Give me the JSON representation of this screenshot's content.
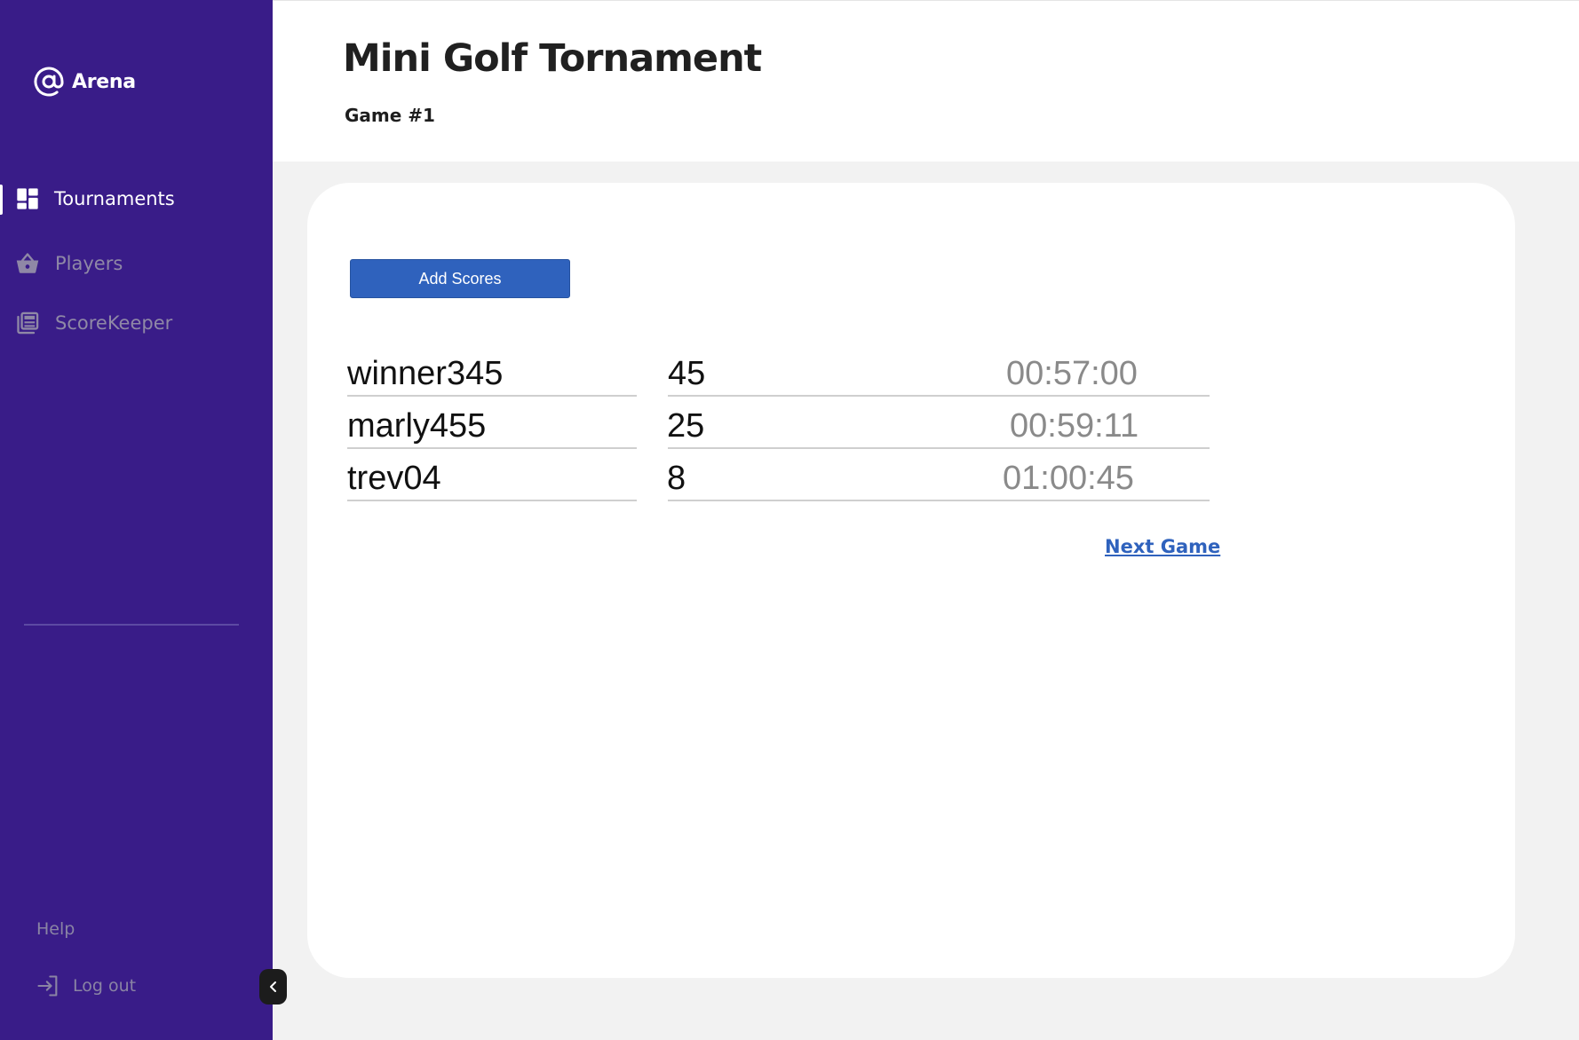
{
  "brand": {
    "name": "Arena",
    "icon": "at-sign-icon"
  },
  "sidebar": {
    "items": [
      {
        "label": "Tournaments",
        "icon": "dashboard-grid-icon",
        "active": true
      },
      {
        "label": "Players",
        "icon": "basket-icon",
        "active": false
      },
      {
        "label": "ScoreKeeper",
        "icon": "newspaper-icon",
        "active": false
      }
    ],
    "help_label": "Help",
    "logout_label": "Log out",
    "logout_icon": "logout-icon",
    "collapse_icon": "chevron-left-icon"
  },
  "header": {
    "title": "Mini Golf Tornament",
    "subtitle": "Game #1"
  },
  "main": {
    "add_scores_label": "Add Scores",
    "scores": [
      {
        "player": "winner345",
        "score": "45",
        "time": "00:57:00"
      },
      {
        "player": "marly455",
        "score": "25",
        "time": "00:59:11"
      },
      {
        "player": "trev04",
        "score": "8",
        "time": "01:00:45"
      }
    ],
    "next_game_label": "Next Game"
  },
  "colors": {
    "sidebar_bg": "#391c88",
    "accent": "#2f62bd",
    "page_bg": "#f2f2f2"
  }
}
